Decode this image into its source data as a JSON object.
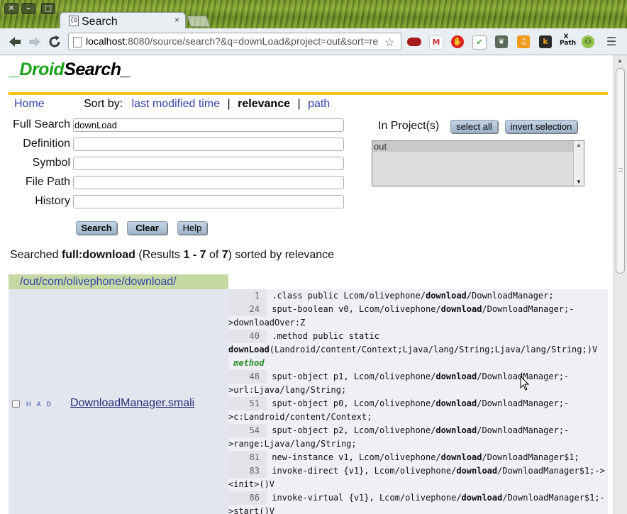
{
  "browser": {
    "tab_title": "Search",
    "favicon_text": "{O",
    "tab_close": "×",
    "url_host": "localhost",
    "url_rest": ":8080/source/search?&q=downLoad&project=out&sort=re",
    "window_buttons": [
      "✕",
      "–",
      "□"
    ],
    "extensions": [
      "onetab-icon",
      "gmail-icon",
      "adblock-icon",
      "todo-icon",
      "evernote-icon",
      "music-icon",
      "k-icon",
      "xpath-icon",
      "tripadvisor-icon"
    ],
    "ext_labels": {
      "xpath": "X\nPath",
      "k": "k"
    }
  },
  "logo": {
    "prefix": "_Droid",
    "suffix": "Search_"
  },
  "nav": {
    "home": "Home",
    "sort_by": "Sort by:",
    "last_modified": "last modified time",
    "sep": "|",
    "relevance": "relevance",
    "path": "path"
  },
  "form": {
    "full_search_label": "Full Search",
    "full_search_value": "downLoad",
    "definition_label": "Definition",
    "symbol_label": "Symbol",
    "file_path_label": "File Path",
    "history_label": "History",
    "search_btn": "Search",
    "clear_btn": "Clear",
    "help_btn": "Help",
    "in_projects_label": "In Project(s)",
    "select_all_btn": "select all",
    "invert_selection_btn": "invert selection",
    "project_options": [
      "out"
    ]
  },
  "summary": {
    "prefix": "Searched ",
    "query": "full:download",
    "results_open": " (Results ",
    "range": "1 - 7",
    "of": " of ",
    "total": "7",
    "results_close": ") sorted by relevance"
  },
  "results": {
    "directory": "/out/com/olivephone/download/",
    "file": "DownloadManager.smali",
    "file_links": "H A D",
    "lines": [
      {
        "ln": "1",
        "pre": ".class public Lcom/olivephone/",
        "hit": "download",
        "post": "/DownloadManager;"
      },
      {
        "ln": "24",
        "pre": "sput-boolean v0, Lcom/olivephone/",
        "hit": "download",
        "post": "/DownloadManager;-"
      },
      {
        "ln": "",
        "pre": ">downloadOver:Z",
        "hit": "",
        "post": ""
      },
      {
        "ln": "40",
        "pre": ".method public static",
        "hit": "",
        "post": ""
      },
      {
        "ln": "",
        "pre": "",
        "hit": "downLoad",
        "post": "(Landroid/content/Context;Ljava/lang/String;Ljava/lang/String;)V"
      },
      {
        "ln": "",
        "pre": "",
        "hit": "",
        "post": "",
        "tag": "method"
      },
      {
        "ln": "48",
        "pre": "sput-object p1, Lcom/olivephone/",
        "hit": "download",
        "post": "/DownloadManager;-"
      },
      {
        "ln": "",
        "pre": ">url:Ljava/lang/String;",
        "hit": "",
        "post": ""
      },
      {
        "ln": "51",
        "pre": "sput-object p0, Lcom/olivephone/",
        "hit": "download",
        "post": "/DownloadManager;-"
      },
      {
        "ln": "",
        "pre": ">c:Landroid/content/Context;",
        "hit": "",
        "post": ""
      },
      {
        "ln": "54",
        "pre": "sput-object p2, Lcom/olivephone/",
        "hit": "download",
        "post": "/DownloadManager;-"
      },
      {
        "ln": "",
        "pre": ">range:Ljava/lang/String;",
        "hit": "",
        "post": ""
      },
      {
        "ln": "81",
        "pre": "new-instance v1, Lcom/olivephone/",
        "hit": "download",
        "post": "/DownloadManager$1;"
      },
      {
        "ln": "83",
        "pre": "invoke-direct {v1}, Lcom/olivephone/",
        "hit": "download",
        "post": "/DownloadManager$1;->"
      },
      {
        "ln": "",
        "pre": "<init>()V",
        "hit": "",
        "post": ""
      },
      {
        "ln": "86",
        "pre": "invoke-virtual {v1}, Lcom/olivephone/",
        "hit": "download",
        "post": "/DownloadManager$1;-"
      },
      {
        "ln": "",
        "pre": ">start()V",
        "hit": "",
        "post": ""
      }
    ]
  },
  "colors": {
    "logo_green": "#1aa31a",
    "rule_yellow": "#f5c21b",
    "dir_bg": "#c6d8a4",
    "link": "#3344aa"
  }
}
